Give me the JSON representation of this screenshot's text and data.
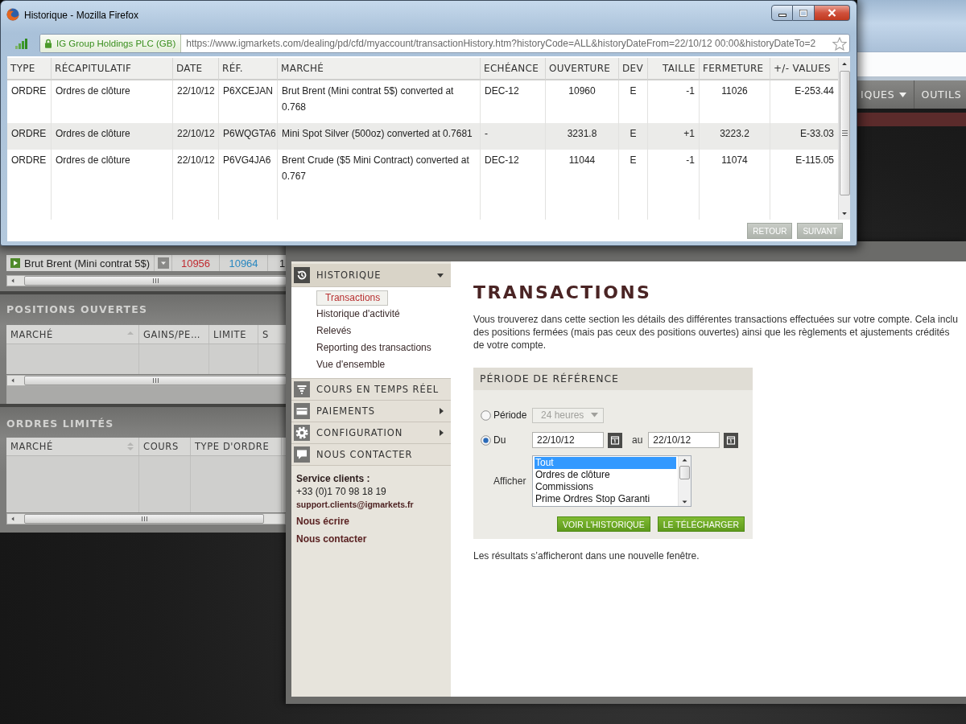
{
  "popup": {
    "title": "Historique - Mozilla Firefox",
    "identity": "IG Group Holdings PLC (GB)",
    "url": "https://www.igmarkets.com/dealing/pd/cfd/myaccount/transactionHistory.htm?historyCode=ALL&historyDateFrom=22/10/12 00:00&historyDateTo=2",
    "table": {
      "columns": [
        "TYPE",
        "RÉCAPITULATIF",
        "DATE",
        "RÉF.",
        "MARCHÉ",
        "ECHÉANCE",
        "OUVERTURE",
        "DEV",
        "TAILLE",
        "FERMETURE",
        "+/- VALUES"
      ],
      "rows": [
        [
          "ORDRE",
          "Ordres de clôture",
          "22/10/12",
          "P6XCEJAN",
          "Brut Brent (Mini contrat 5$) converted at 0.768",
          "DEC-12",
          "10960",
          "E",
          "-1",
          "11026",
          "E-253.44"
        ],
        [
          "ORDRE",
          "Ordres de clôture",
          "22/10/12",
          "P6WQGTA6",
          "Mini Spot Silver (500oz) converted at 0.7681",
          "-",
          "3231.8",
          "E",
          "+1",
          "3223.2",
          "E-33.03"
        ],
        [
          "ORDRE",
          "Ordres de clôture",
          "22/10/12",
          "P6VG4JA6",
          "Brent Crude ($5 Mini Contract) converted at 0.767",
          "DEC-12",
          "11044",
          "E",
          "-1",
          "11074",
          "E-115.05"
        ]
      ]
    },
    "buttons": [
      "RETOUR",
      "SUIVANT"
    ]
  },
  "background_window": {
    "nav": [
      {
        "label": "IQUES",
        "kind": "dropdown"
      },
      {
        "label": "OUTILS",
        "kind": "link"
      }
    ]
  },
  "watchlist": {
    "market": "Brut Brent (Mini contrat 5$)",
    "prices": [
      "10956",
      "10964"
    ],
    "column_5": "1"
  },
  "panels": [
    {
      "title": "POSITIONS OUVERTES",
      "columns": [
        {
          "label": "MARCHÉ",
          "sorted": true
        },
        {
          "label": "GAINS/PE…"
        },
        {
          "label": "LIMITE"
        },
        {
          "label": "S"
        }
      ]
    },
    {
      "title": "ORDRES LIMITÉS",
      "columns": [
        {
          "label": "MARCHÉ",
          "sorted": false
        },
        {
          "label": "COURS"
        },
        {
          "label": "TYPE D'ORDRE"
        }
      ]
    }
  ],
  "account": {
    "menu": [
      {
        "label": "HISTORIQUE",
        "kind": "group",
        "expanded": true,
        "children": [
          {
            "label": "Transactions",
            "selected": true
          },
          {
            "label": "Historique d'activité",
            "selected": false
          },
          {
            "label": "Relevés",
            "selected": false
          },
          {
            "label": "Reporting des transactions",
            "selected": false
          },
          {
            "label": "Vue d'ensemble",
            "selected": false
          }
        ]
      },
      {
        "label": "COURS EN TEMPS RÉEL",
        "kind": "link"
      },
      {
        "label": "PAIEMENTS",
        "kind": "group",
        "expanded": false
      },
      {
        "label": "CONFIGURATION",
        "kind": "group",
        "expanded": false
      },
      {
        "label": "NOUS CONTACTER",
        "kind": "link"
      }
    ],
    "contact": {
      "title": "Service clients :",
      "phone": "+33 (0)1 70 98 18 19",
      "email": "support.clients@igmarkets.fr",
      "links": [
        "Nous écrire",
        "Nous contacter"
      ]
    },
    "content": {
      "title": "TRANSACTIONS",
      "intro": "Vous trouverez dans cette section les détails des différentes transactions effectuées sur votre compte. Cela inclu\ndes positions fermées (mais pas ceux des positions ouvertes) ainsi que les règlements et ajustements crédités\nde votre compte.",
      "form": {
        "title": "PÉRIODE DE RÉFÉRENCE",
        "period": {
          "label": "Période",
          "selected": false,
          "value": "24 heures",
          "disabled": true
        },
        "range": {
          "label": "Du",
          "selected": true,
          "from": "22/10/12",
          "joiner": "au",
          "to": "22/10/12"
        },
        "show": {
          "label": "Afficher",
          "options": [
            {
              "label": "Tout",
              "selected": true
            },
            {
              "label": "Ordres de clôture",
              "selected": false
            },
            {
              "label": "Commissions",
              "selected": false
            },
            {
              "label": "Prime Ordres Stop Garanti",
              "selected": false
            }
          ]
        },
        "buttons": [
          "VOIR L'HISTORIQUE",
          "LE TÉLÉCHARGER"
        ]
      },
      "note": "Les résultats s’afficheront dans une nouvelle fenêtre."
    }
  }
}
